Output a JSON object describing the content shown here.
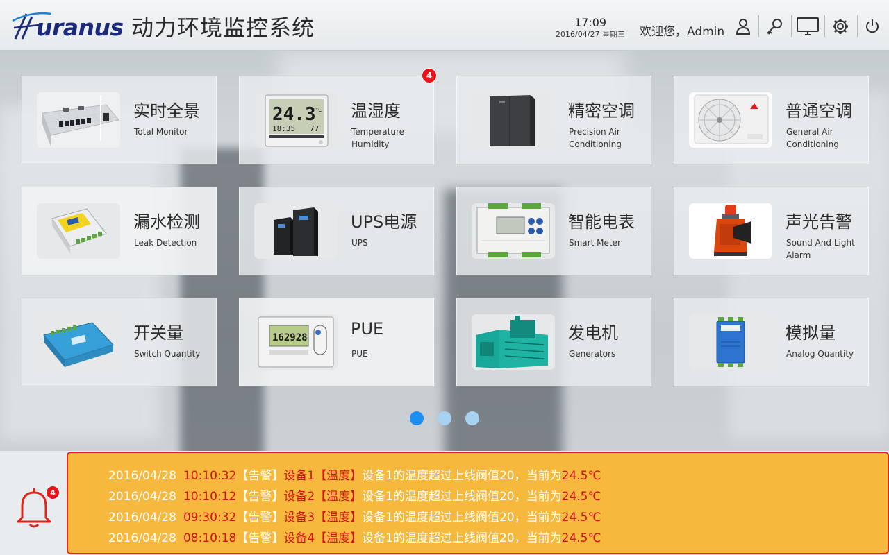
{
  "header": {
    "logo_text": "uranus",
    "title": "动力环境监控系统",
    "time": "17:09",
    "date": "2016/04/27 星期三",
    "welcome": "欢迎您，Admin"
  },
  "tiles": [
    {
      "cn": "实时全景",
      "en": "Total Monitor",
      "image": "data-center-3d-image"
    },
    {
      "cn": "温湿度",
      "en": "Temperature Humidity",
      "image": "thermo-hygrometer-image",
      "badge": "4"
    },
    {
      "cn": "精密空调",
      "en": "Precision Air Conditioning",
      "image": "precision-ac-cabinet-image"
    },
    {
      "cn": "普通空调",
      "en": "General Air Conditioning",
      "image": "split-ac-unit-image"
    },
    {
      "cn": "漏水检测",
      "en": "Leak Detection",
      "image": "leak-detector-module-image"
    },
    {
      "cn": "UPS电源",
      "en": "UPS",
      "image": "ups-tower-image"
    },
    {
      "cn": "智能电表",
      "en": "Smart Meter",
      "image": "smart-meter-image"
    },
    {
      "cn": "声光告警",
      "en": "Sound And Light Alarm",
      "image": "siren-beacon-image"
    },
    {
      "cn": "开关量",
      "en": "Switch Quantity",
      "image": "switch-io-module-image"
    },
    {
      "cn": "PUE",
      "en": "PUE",
      "image": "power-meter-image",
      "lcd": "162928"
    },
    {
      "cn": "发电机",
      "en": "Generators",
      "image": "diesel-generator-image"
    },
    {
      "cn": "模拟量",
      "en": "Analog Quantity",
      "image": "analog-io-module-image"
    }
  ],
  "thermo_display": {
    "main": "24.3",
    "unit": "°C",
    "time": "18:35",
    "humidity": "77"
  },
  "pagination": {
    "pages": 3,
    "current": 1
  },
  "alarms": {
    "count": "4",
    "items": [
      {
        "date": "2016/04/28",
        "time": "10:10:32",
        "level": "【告警】",
        "device": "设备1",
        "category": "【温度】",
        "message": "设备1的温度超过上线阀值20，当前为",
        "value": "24.5℃"
      },
      {
        "date": "2016/04/28",
        "time": "10:10:12",
        "level": "【告警】",
        "device": "设备2",
        "category": "【温度】",
        "message": "设备1的温度超过上线阀值20，当前为",
        "value": "24.5℃"
      },
      {
        "date": "2016/04/28",
        "time": "09:30:32",
        "level": "【告警】",
        "device": "设备3",
        "category": "【温度】",
        "message": "设备1的温度超过上线阀值20，当前为",
        "value": "24.5℃"
      },
      {
        "date": "2016/04/28",
        "time": "08:10:18",
        "level": "【告警】",
        "device": "设备4",
        "category": "【温度】",
        "message": "设备1的温度超过上线阀值20，当前为",
        "value": "24.5℃"
      }
    ]
  },
  "colors": {
    "accent": "#1b8ff2",
    "alarm_panel": "#f6b93e",
    "alarm_border": "#e0261c",
    "alarm_text": "#d3120f",
    "badge": "#e8131b"
  }
}
